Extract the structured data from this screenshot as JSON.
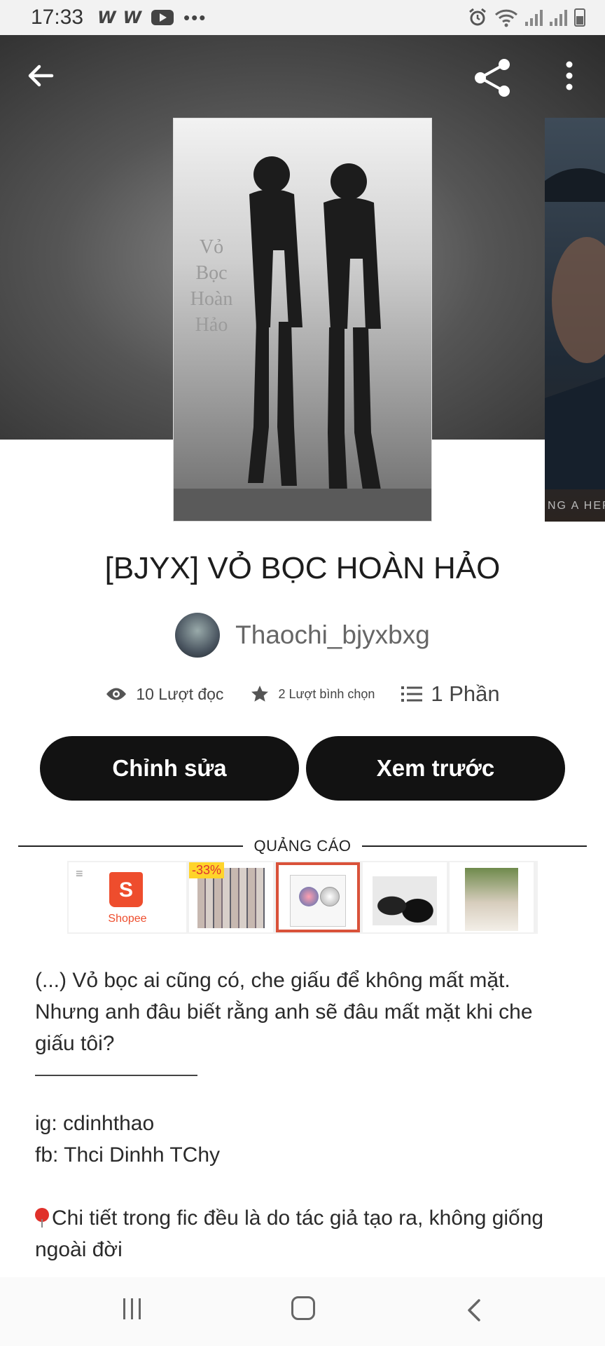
{
  "status_bar": {
    "time": "17:33",
    "app_icons": [
      "W",
      "W"
    ],
    "more": "•••"
  },
  "header": {
    "back_icon": "arrow-left-icon",
    "share_icon": "share-icon",
    "more_icon": "more-vertical-icon"
  },
  "cover": {
    "overlay_text": [
      "Vỏ",
      "Bọc",
      "Hoàn",
      "Hảo"
    ],
    "next_cover_text": "NG A HERO"
  },
  "story": {
    "title": "[BJYX] VỎ BỌC HOÀN HẢO",
    "author": "Thaochi_bjyxbxg",
    "reads": "10 Lượt đọc",
    "votes": "2 Lượt bình chọn",
    "parts": "1 Phần"
  },
  "actions": {
    "edit_label": "Chỉnh sửa",
    "preview_label": "Xem trước"
  },
  "ad": {
    "label": "QUẢNG CÁO",
    "shopee_letter": "S",
    "shopee_word": "Shopee",
    "discount": "-33%"
  },
  "description": {
    "paragraph1": "(...) Vỏ bọc ai cũng có, che giấu để không mất mặt. Nhưng anh đâu biết rằng anh sẽ đâu mất mặt khi che giấu tôi?",
    "ig": "ig: cdinhthao",
    "fb": "fb: Thci Dinhh TChy",
    "note": "Chi tiết trong fic đều là do tác giả tạo ra, không giống ngoài đời"
  },
  "colors": {
    "button_bg": "#121212",
    "shopee": "#ee4d2d",
    "selected_ad_border": "#d9523a",
    "pin": "#e0302a"
  }
}
